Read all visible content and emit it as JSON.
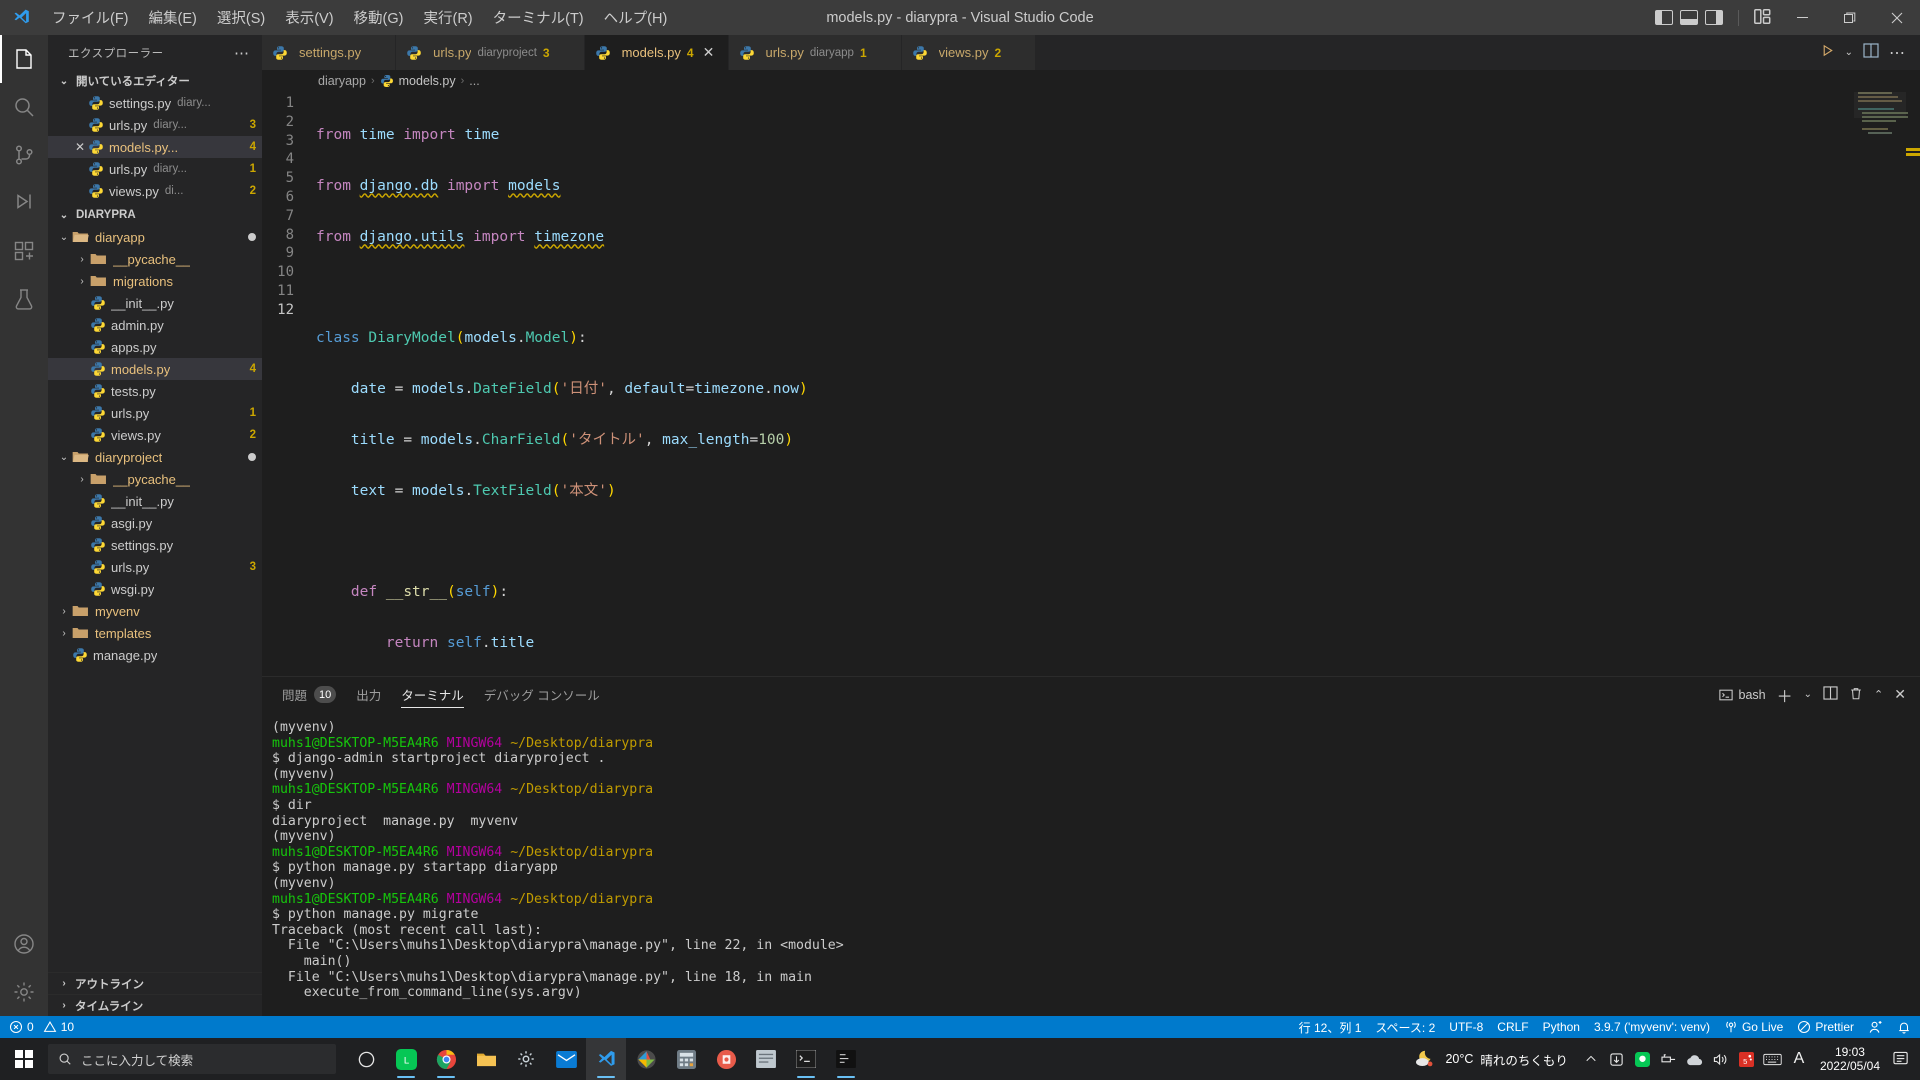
{
  "window": {
    "title": "models.py - diarypra - Visual Studio Code",
    "menu": [
      "ファイル(F)",
      "編集(E)",
      "選択(S)",
      "表示(V)",
      "移動(G)",
      "実行(R)",
      "ターミナル(T)",
      "ヘルプ(H)"
    ],
    "layout_icons": [
      "panel-left-icon",
      "panel-bottom-icon",
      "panel-right-icon",
      "customize-layout-icon"
    ],
    "controls": {
      "minimize": "–",
      "maximize": "❐",
      "close": "✕"
    }
  },
  "activitybar": {
    "items": [
      {
        "name": "explorer",
        "icon": "files-icon",
        "active": true
      },
      {
        "name": "search",
        "icon": "search-icon",
        "active": false
      },
      {
        "name": "source-control",
        "icon": "source-control-icon",
        "active": false
      },
      {
        "name": "run-and-debug",
        "icon": "debug-icon",
        "active": false
      },
      {
        "name": "extensions",
        "icon": "extensions-icon",
        "active": false
      },
      {
        "name": "testing",
        "icon": "beaker-icon",
        "active": false
      }
    ],
    "bottom": [
      {
        "name": "accounts",
        "icon": "account-icon"
      },
      {
        "name": "manage",
        "icon": "gear-icon"
      }
    ]
  },
  "sidebar": {
    "title": "エクスプローラー",
    "more_actions": "⋯",
    "open_editors": {
      "label": "開いているエディター",
      "items": [
        {
          "name": "settings.py",
          "desc": "diary...",
          "badge": "",
          "selected": false,
          "show_close": false
        },
        {
          "name": "urls.py",
          "desc": "diary...",
          "badge": "3",
          "selected": false,
          "show_close": false
        },
        {
          "name": "models.py...",
          "desc": "",
          "badge": "4",
          "selected": true,
          "show_close": true
        },
        {
          "name": "urls.py",
          "desc": "diary...",
          "badge": "1",
          "selected": false,
          "show_close": false
        },
        {
          "name": "views.py",
          "desc": "di...",
          "badge": "2",
          "selected": false,
          "show_close": false
        }
      ]
    },
    "project": {
      "label": "DIARYPRA",
      "tree": [
        {
          "label": "diaryapp",
          "type": "folder",
          "depth": 1,
          "expanded": true,
          "dirty": true,
          "badge": ""
        },
        {
          "label": "__pycache__",
          "type": "folder",
          "depth": 2,
          "expanded": false,
          "dirty": false,
          "badge": ""
        },
        {
          "label": "migrations",
          "type": "folder",
          "depth": 2,
          "expanded": false,
          "dirty": false,
          "badge": ""
        },
        {
          "label": "__init__.py",
          "type": "file",
          "depth": 2,
          "expanded": null,
          "dirty": false,
          "badge": ""
        },
        {
          "label": "admin.py",
          "type": "file",
          "depth": 2,
          "expanded": null,
          "dirty": false,
          "badge": ""
        },
        {
          "label": "apps.py",
          "type": "file",
          "depth": 2,
          "expanded": null,
          "dirty": false,
          "badge": ""
        },
        {
          "label": "models.py",
          "type": "file",
          "depth": 2,
          "expanded": null,
          "dirty": false,
          "badge": "4",
          "selected": true
        },
        {
          "label": "tests.py",
          "type": "file",
          "depth": 2,
          "expanded": null,
          "dirty": false,
          "badge": ""
        },
        {
          "label": "urls.py",
          "type": "file",
          "depth": 2,
          "expanded": null,
          "dirty": false,
          "badge": "1"
        },
        {
          "label": "views.py",
          "type": "file",
          "depth": 2,
          "expanded": null,
          "dirty": false,
          "badge": "2"
        },
        {
          "label": "diaryproject",
          "type": "folder",
          "depth": 1,
          "expanded": true,
          "dirty": true,
          "badge": ""
        },
        {
          "label": "__pycache__",
          "type": "folder",
          "depth": 2,
          "expanded": false,
          "dirty": false,
          "badge": ""
        },
        {
          "label": "__init__.py",
          "type": "file",
          "depth": 2,
          "expanded": null,
          "dirty": false,
          "badge": ""
        },
        {
          "label": "asgi.py",
          "type": "file",
          "depth": 2,
          "expanded": null,
          "dirty": false,
          "badge": ""
        },
        {
          "label": "settings.py",
          "type": "file",
          "depth": 2,
          "expanded": null,
          "dirty": false,
          "badge": ""
        },
        {
          "label": "urls.py",
          "type": "file",
          "depth": 2,
          "expanded": null,
          "dirty": false,
          "badge": "3"
        },
        {
          "label": "wsgi.py",
          "type": "file",
          "depth": 2,
          "expanded": null,
          "dirty": false,
          "badge": ""
        },
        {
          "label": "myvenv",
          "type": "folder",
          "depth": 1,
          "expanded": false,
          "dirty": false,
          "badge": ""
        },
        {
          "label": "templates",
          "type": "folder",
          "depth": 1,
          "expanded": false,
          "dirty": false,
          "badge": ""
        },
        {
          "label": "manage.py",
          "type": "file",
          "depth": 1,
          "expanded": null,
          "dirty": false,
          "badge": ""
        }
      ]
    },
    "footer": [
      {
        "label": "アウトライン"
      },
      {
        "label": "タイムライン"
      }
    ]
  },
  "editor": {
    "tabs": [
      {
        "name": "settings.py",
        "desc": "",
        "badge": "",
        "active": false,
        "close": false
      },
      {
        "name": "urls.py",
        "desc": "diaryproject",
        "badge": "3",
        "active": false,
        "close": false
      },
      {
        "name": "models.py",
        "desc": "",
        "badge": "4",
        "active": true,
        "close": true
      },
      {
        "name": "urls.py",
        "desc": "diaryapp",
        "badge": "1",
        "active": false,
        "close": false
      },
      {
        "name": "views.py",
        "desc": "",
        "badge": "2",
        "active": false,
        "close": false
      }
    ],
    "tab_actions": [
      "run-icon",
      "chevron-down-icon",
      "split-editor-icon",
      "more-actions-icon"
    ],
    "breadcrumb": [
      "diaryapp",
      "models.py",
      "..."
    ],
    "line_numbers": [
      "1",
      "2",
      "3",
      "4",
      "5",
      "6",
      "7",
      "8",
      "9",
      "10",
      "11",
      "12"
    ],
    "current_line": 12,
    "code_text": [
      "from time import time",
      "from django.db import models",
      "from django.utils import timezone",
      "",
      "class DiaryModel(models.Model):",
      "    date = models.DateField('日付', default=timezone.now)",
      "    title = models.CharField('タイトル', max_length=100)",
      "    text = models.TextField('本文')",
      "",
      "    def __str__(self):",
      "        return self.title",
      ""
    ]
  },
  "panel": {
    "tabs": [
      {
        "label": "問題",
        "badge": "10",
        "active": false
      },
      {
        "label": "出力",
        "badge": "",
        "active": false
      },
      {
        "label": "ターミナル",
        "badge": "",
        "active": true
      },
      {
        "label": "デバッグ コンソール",
        "badge": "",
        "active": false
      }
    ],
    "shell_label": "bash",
    "actions": [
      "new-terminal-icon",
      "chevron-down-icon",
      "split-terminal-icon",
      "kill-terminal-icon",
      "maximize-panel-icon",
      "close-panel-icon"
    ],
    "terminal_lines": [
      [
        {
          "t": "(myvenv)",
          "c": "white"
        }
      ],
      [
        {
          "t": "muhs1@DESKTOP-M5EA4R6 ",
          "c": "green"
        },
        {
          "t": "MINGW64 ",
          "c": "purple"
        },
        {
          "t": "~/Desktop/diarypra",
          "c": "yellow"
        }
      ],
      [
        {
          "t": "$ django-admin startproject diaryproject .",
          "c": "white"
        }
      ],
      [
        {
          "t": "(myvenv)",
          "c": "white"
        }
      ],
      [
        {
          "t": "muhs1@DESKTOP-M5EA4R6 ",
          "c": "green"
        },
        {
          "t": "MINGW64 ",
          "c": "purple"
        },
        {
          "t": "~/Desktop/diarypra",
          "c": "yellow"
        }
      ],
      [
        {
          "t": "$ dir",
          "c": "white"
        }
      ],
      [
        {
          "t": "diaryproject  manage.py  myvenv",
          "c": "white"
        }
      ],
      [
        {
          "t": "(myvenv)",
          "c": "white"
        }
      ],
      [
        {
          "t": "muhs1@DESKTOP-M5EA4R6 ",
          "c": "green"
        },
        {
          "t": "MINGW64 ",
          "c": "purple"
        },
        {
          "t": "~/Desktop/diarypra",
          "c": "yellow"
        }
      ],
      [
        {
          "t": "$ python manage.py startapp diaryapp",
          "c": "white"
        }
      ],
      [
        {
          "t": "(myvenv)",
          "c": "white"
        }
      ],
      [
        {
          "t": "muhs1@DESKTOP-M5EA4R6 ",
          "c": "green"
        },
        {
          "t": "MINGW64 ",
          "c": "purple"
        },
        {
          "t": "~/Desktop/diarypra",
          "c": "yellow"
        }
      ],
      [
        {
          "t": "$ python manage.py migrate",
          "c": "white"
        }
      ],
      [
        {
          "t": "Traceback (most recent call last):",
          "c": "white"
        }
      ],
      [
        {
          "t": "  File \"C:\\Users\\muhs1\\Desktop\\diarypra\\manage.py\", line 22, in <module>",
          "c": "white"
        }
      ],
      [
        {
          "t": "    main()",
          "c": "white"
        }
      ],
      [
        {
          "t": "  File \"C:\\Users\\muhs1\\Desktop\\diarypra\\manage.py\", line 18, in main",
          "c": "white"
        }
      ],
      [
        {
          "t": "    execute_from_command_line(sys.argv)",
          "c": "white"
        }
      ]
    ]
  },
  "statusbar": {
    "left": [
      {
        "name": "remote-errors",
        "icon": "error-icon",
        "text": "0"
      },
      {
        "name": "remote-warnings",
        "icon": "warning-icon",
        "text": "10"
      }
    ],
    "right": [
      {
        "name": "editor-position",
        "text": "行 12、列 1"
      },
      {
        "name": "indentation",
        "text": "スペース: 2"
      },
      {
        "name": "encoding",
        "text": "UTF-8"
      },
      {
        "name": "eol",
        "text": "CRLF"
      },
      {
        "name": "language-mode",
        "text": "Python"
      },
      {
        "name": "python-interpreter",
        "text": "3.9.7 ('myvenv': venv)"
      },
      {
        "name": "go-live",
        "text": "Go Live",
        "icon": "broadcast-icon"
      },
      {
        "name": "prettier",
        "text": "Prettier",
        "icon": "prettier-check-icon"
      },
      {
        "name": "accounts",
        "text": "",
        "icon": "account-icon"
      },
      {
        "name": "notifications",
        "text": "",
        "icon": "bell-icon"
      }
    ]
  },
  "taskbar": {
    "start": "windows-start-icon",
    "search_placeholder": "ここに入力して検索",
    "apps": [
      {
        "name": "cortana-icon",
        "running": false,
        "active": false
      },
      {
        "name": "line-app-icon",
        "running": true,
        "active": false
      },
      {
        "name": "chrome-icon",
        "running": true,
        "active": false
      },
      {
        "name": "file-explorer-icon",
        "running": false,
        "active": false
      },
      {
        "name": "settings-icon",
        "running": false,
        "active": false
      },
      {
        "name": "mail-icon",
        "running": false,
        "active": false
      },
      {
        "name": "vscode-icon",
        "running": true,
        "active": true
      },
      {
        "name": "photos-icon",
        "running": false,
        "active": false
      },
      {
        "name": "calculator-icon",
        "running": false,
        "active": false
      },
      {
        "name": "store-icon",
        "running": false,
        "active": false
      },
      {
        "name": "notepad-icon",
        "running": false,
        "active": false
      },
      {
        "name": "terminal-icon",
        "running": true,
        "active": false
      },
      {
        "name": "git-bash-icon",
        "running": true,
        "active": false
      }
    ],
    "weather": {
      "temp": "20°C",
      "condition": "晴れのちくもり",
      "icon": "night-partly-cloudy-icon"
    },
    "tray": [
      "chevron-up-icon",
      "onedrive-sync-icon",
      "line-tray-icon",
      "usb-eject-icon",
      "cloud-icon",
      "volume-icon",
      "fifth-app-icon",
      "keyboard-icon",
      "ime-a-icon"
    ],
    "clock": {
      "time": "19:03",
      "date": "2022/05/04"
    },
    "action_center": "notification-icon"
  }
}
